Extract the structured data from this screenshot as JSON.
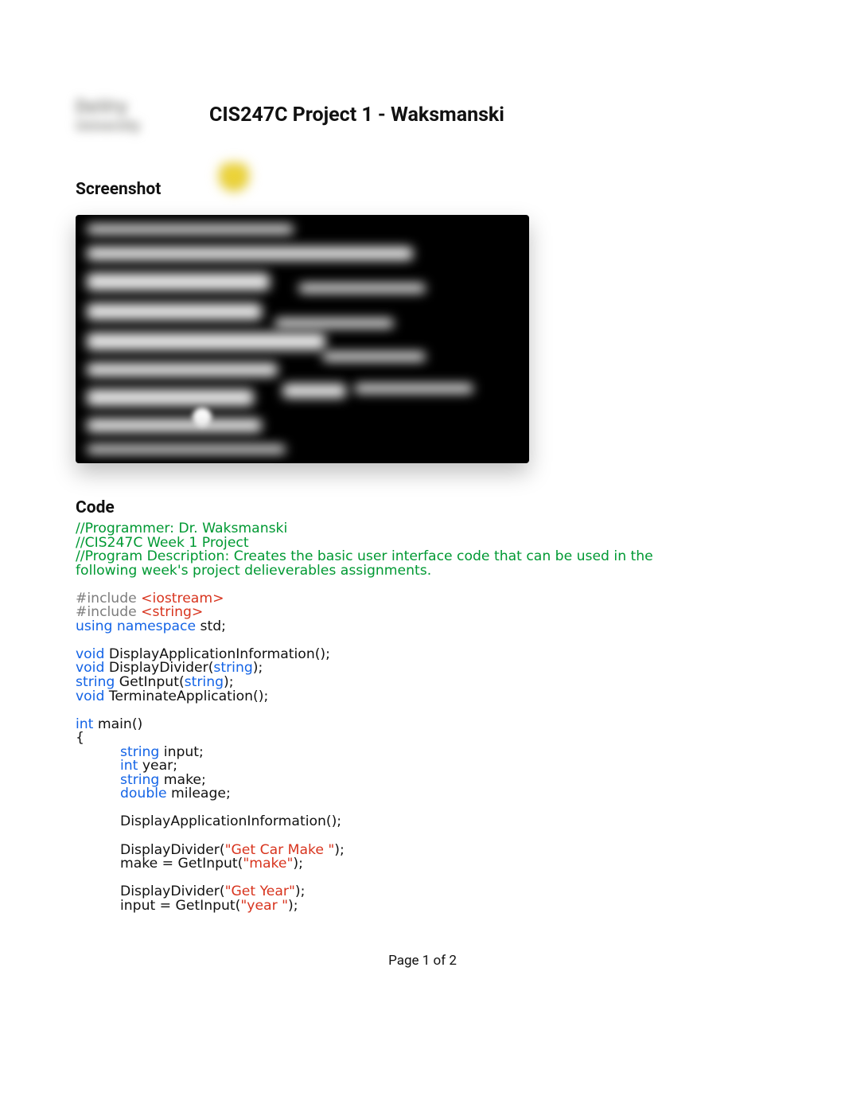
{
  "header": {
    "logo_top": "DeVry",
    "logo_bottom": "University",
    "title": "CIS247C Project 1 - Waksmanski"
  },
  "sections": {
    "screenshot_heading": "Screenshot",
    "code_heading": "Code"
  },
  "code": {
    "comment1": "//Programmer: Dr. Waksmanski",
    "comment2": "//CIS247C Week 1 Project",
    "comment3": "//Program Description: Creates the basic user interface code that can be used in the following week's project delieverables assignments.",
    "include_kw": "#include",
    "include_iostream": "<iostream>",
    "include_string": "<string>",
    "using": "using",
    "namespace": "namespace",
    "std": " std;",
    "void": "void",
    "string_kw": "string",
    "int_kw": "int",
    "double_kw": "double",
    "fn_display_app_info_decl": " DisplayApplicationInformation();",
    "fn_display_divider_pre": " DisplayDivider(",
    "fn_display_divider_post": ");",
    "fn_getinput_pre": " GetInput(",
    "fn_getinput_post": ");",
    "fn_terminate_decl": " TerminateApplication();",
    "main_sig": " main()",
    "open_brace": "{",
    "var_input": " input;",
    "var_year": " year;",
    "var_make": " make;",
    "var_mileage": " mileage;",
    "call_display_app_info": "DisplayApplicationInformation();",
    "call_display_divider_open": "DisplayDivider(",
    "call_display_divider_close": ");",
    "call_getinput_open_make": "make = GetInput(",
    "call_getinput_open_input": "input = GetInput(",
    "call_getinput_close": ");",
    "str_get_car_make": "\"Get Car Make \"",
    "str_make": "\"make\"",
    "str_get_year": "\"Get Year\"",
    "str_year": "\"year \""
  },
  "footer": {
    "page_label": "Page 1 of 2"
  }
}
